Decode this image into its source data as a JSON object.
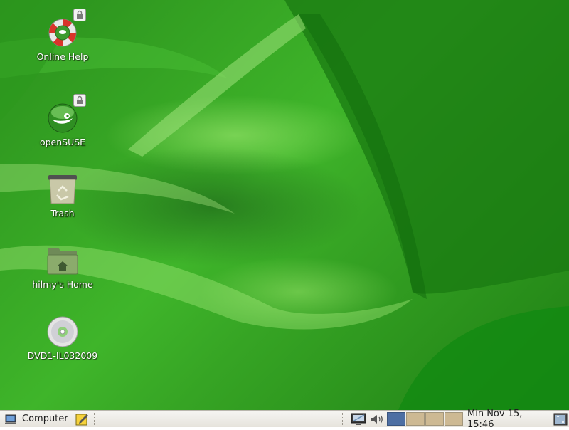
{
  "desktop": {
    "icons": [
      {
        "label": "Online Help",
        "icon": "help-lifebuoy-icon",
        "locked": true
      },
      {
        "label": "openSUSE",
        "icon": "opensuse-icon",
        "locked": true
      },
      {
        "label": "Trash",
        "icon": "trash-icon",
        "locked": false
      },
      {
        "label": "hilmy's Home",
        "icon": "home-folder-icon",
        "locked": false
      },
      {
        "label": "DVD1-IL032009",
        "icon": "dvd-icon",
        "locked": false
      }
    ]
  },
  "taskbar": {
    "menu_label": "Computer",
    "clock": "Min Nov 15, 15:46",
    "workspaces": {
      "count": 4,
      "active": 1
    },
    "colors": {
      "active_workspace": "#4e6fa3",
      "inactive_workspace": "#cdb993",
      "panel": "#eeece6"
    }
  }
}
